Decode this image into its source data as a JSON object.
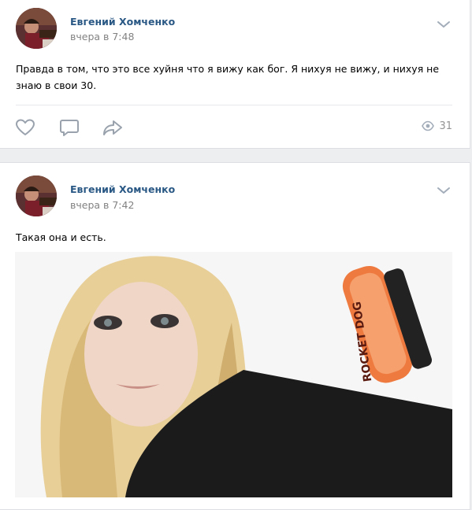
{
  "posts": [
    {
      "author": "Евгений Хомченко",
      "time": "вчера в 7:48",
      "text": "Правда в том, что это все хуйня что я вижу как бог. Я нихуя не вижу, и нихуя не знаю в свои 30.",
      "views": "31",
      "icons": [
        "heart-icon",
        "comment-icon",
        "share-arrow-icon",
        "eye-icon",
        "chevron-down-icon"
      ]
    },
    {
      "author": "Евгений Хомченко",
      "time": "вчера в 7:42",
      "text": "Такая она и есть.",
      "photo_text": "ROCKET DOG"
    }
  ],
  "colors": {
    "author": "#2a5885",
    "muted": "#828282",
    "icon": "#99a2ad",
    "background": "#edeef0"
  }
}
